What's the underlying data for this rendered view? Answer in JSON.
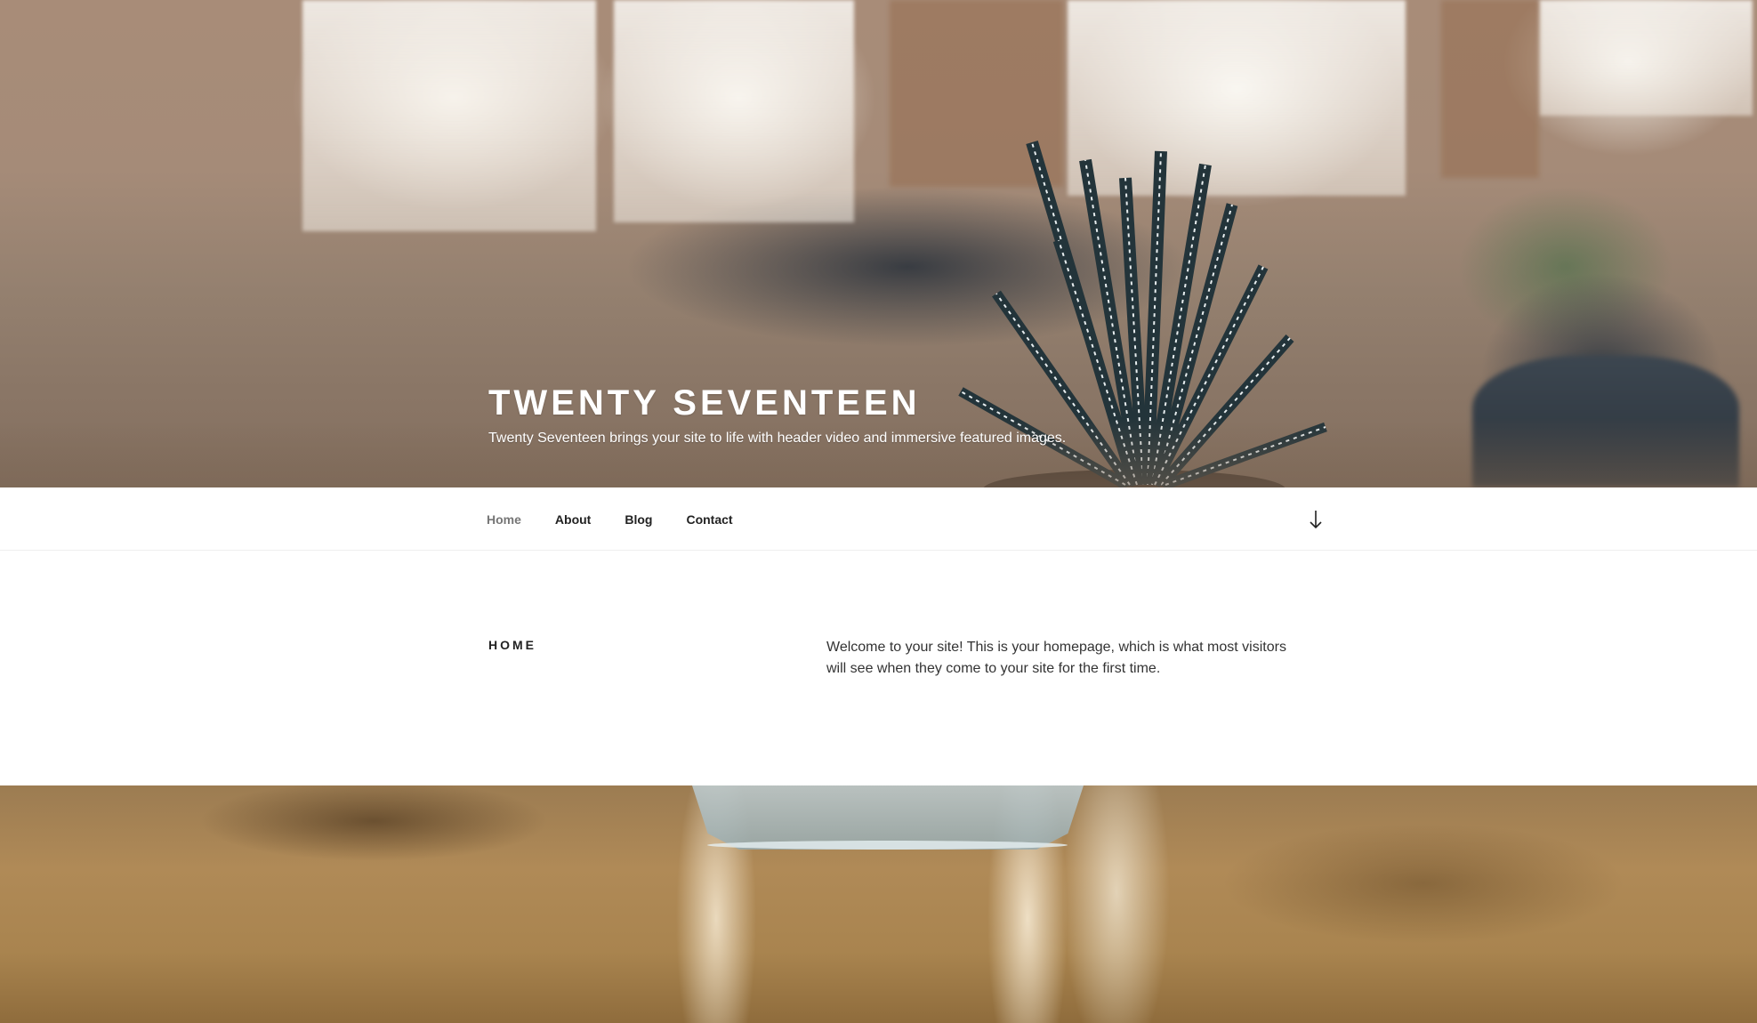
{
  "site": {
    "title": "TWENTY SEVENTEEN",
    "description": "Twenty Seventeen brings your site to life with header video and immersive featured images."
  },
  "nav": {
    "items": [
      {
        "label": "Home",
        "current": true
      },
      {
        "label": "About",
        "current": false
      },
      {
        "label": "Blog",
        "current": false
      },
      {
        "label": "Contact",
        "current": false
      }
    ],
    "scroll_icon": "arrow-down-icon"
  },
  "page": {
    "title": "HOME",
    "content": "Welcome to your site! This is your homepage, which is what most visitors will see when they come to your site for the first time."
  },
  "colors": {
    "text": "#222222",
    "nav_current": "#767676",
    "body_text": "#333333"
  }
}
